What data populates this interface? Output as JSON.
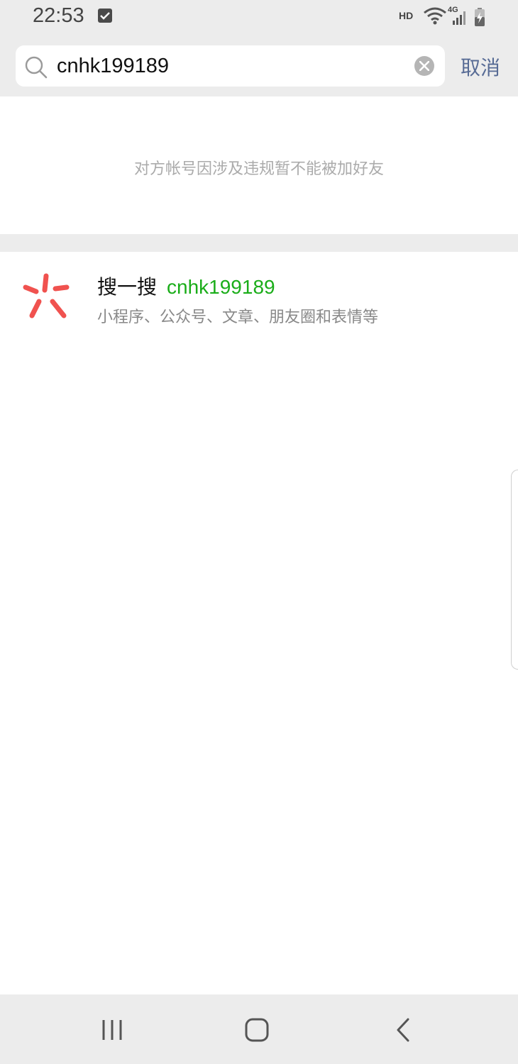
{
  "status_bar": {
    "time": "22:53",
    "hd_label": "HD",
    "network_label": "4G"
  },
  "search": {
    "query": "cnhk199189",
    "cancel_label": "取消"
  },
  "notice": {
    "message": "对方帐号因涉及违规暂不能被加好友"
  },
  "result": {
    "title": "搜一搜",
    "keyword": "cnhk199189",
    "subtitle": "小程序、公众号、文章、朋友圈和表情等"
  },
  "colors": {
    "accent_link": "#576b95",
    "keyword_green": "#1aad19",
    "sou_icon_red": "#f0524f",
    "header_gray": "#ececec"
  },
  "icons": [
    "check-icon",
    "wifi-icon",
    "signal-icon",
    "battery-icon",
    "search-icon",
    "clear-icon",
    "sou-yi-sou-icon",
    "recent-apps-icon",
    "home-icon",
    "back-icon"
  ]
}
